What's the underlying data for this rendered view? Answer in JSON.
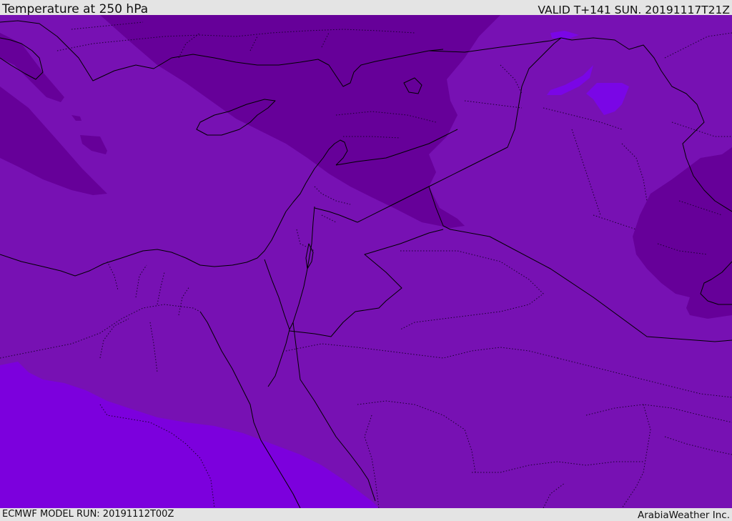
{
  "header": {
    "title": "Temperature at 250 hPa",
    "valid": "VALID T+141 SUN. 20191117T21Z"
  },
  "footer": {
    "model_run": "ECMWF MODEL RUN: 20191112T00Z",
    "credit": "ArabiaWeather Inc."
  },
  "colors": {
    "band_base": "#7711b3",
    "band_cold": "#660099",
    "band_warm": "#7c00dd",
    "band_warm_light": "#7a06e6",
    "coastline": "#000000",
    "background": "#e4e4e4"
  },
  "layers": [
    "temperature-band-base",
    "temperature-band-cold",
    "temperature-band-warm",
    "coastlines",
    "country-borders",
    "region-borders"
  ]
}
